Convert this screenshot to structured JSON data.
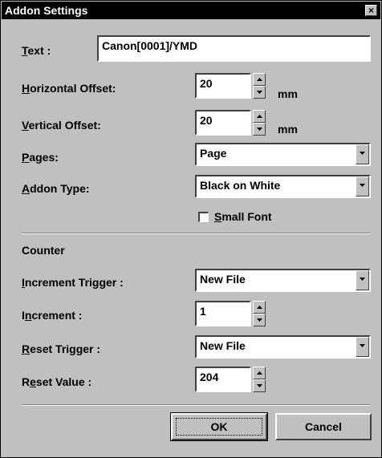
{
  "window": {
    "title": "Addon Settings",
    "close_glyph": "×"
  },
  "text": {
    "label_ul": "T",
    "label_rest": "ext :",
    "value": "Canon[0001]/YMD"
  },
  "horizontal_offset": {
    "label_ul": "H",
    "label_rest": "orizontal Offset:",
    "value": "20",
    "unit": "mm"
  },
  "vertical_offset": {
    "label_ul": "V",
    "label_rest": "ertical Offset:",
    "value": "20",
    "unit": "mm"
  },
  "pages": {
    "label_ul": "P",
    "label_rest": "ages:",
    "value": "Page"
  },
  "addon_type": {
    "label_ul": "A",
    "label_rest": "ddon Type:",
    "value": "Black on White"
  },
  "small_font": {
    "label_ul": "S",
    "label_rest": "mall Font",
    "checked": false
  },
  "counter": {
    "heading": "Counter"
  },
  "increment_trigger": {
    "label_ul": "I",
    "label_rest": "ncrement Trigger :",
    "value": "New File"
  },
  "increment": {
    "label_pre": "I",
    "label_ul": "n",
    "label_rest": "crement :",
    "value": "1"
  },
  "reset_trigger": {
    "label_ul": "R",
    "label_rest": "eset Trigger :",
    "value": "New File"
  },
  "reset_value": {
    "label_pre": "R",
    "label_ul": "e",
    "label_rest": "set Value :",
    "value": "204"
  },
  "buttons": {
    "ok": "OK",
    "cancel": "Cancel"
  }
}
